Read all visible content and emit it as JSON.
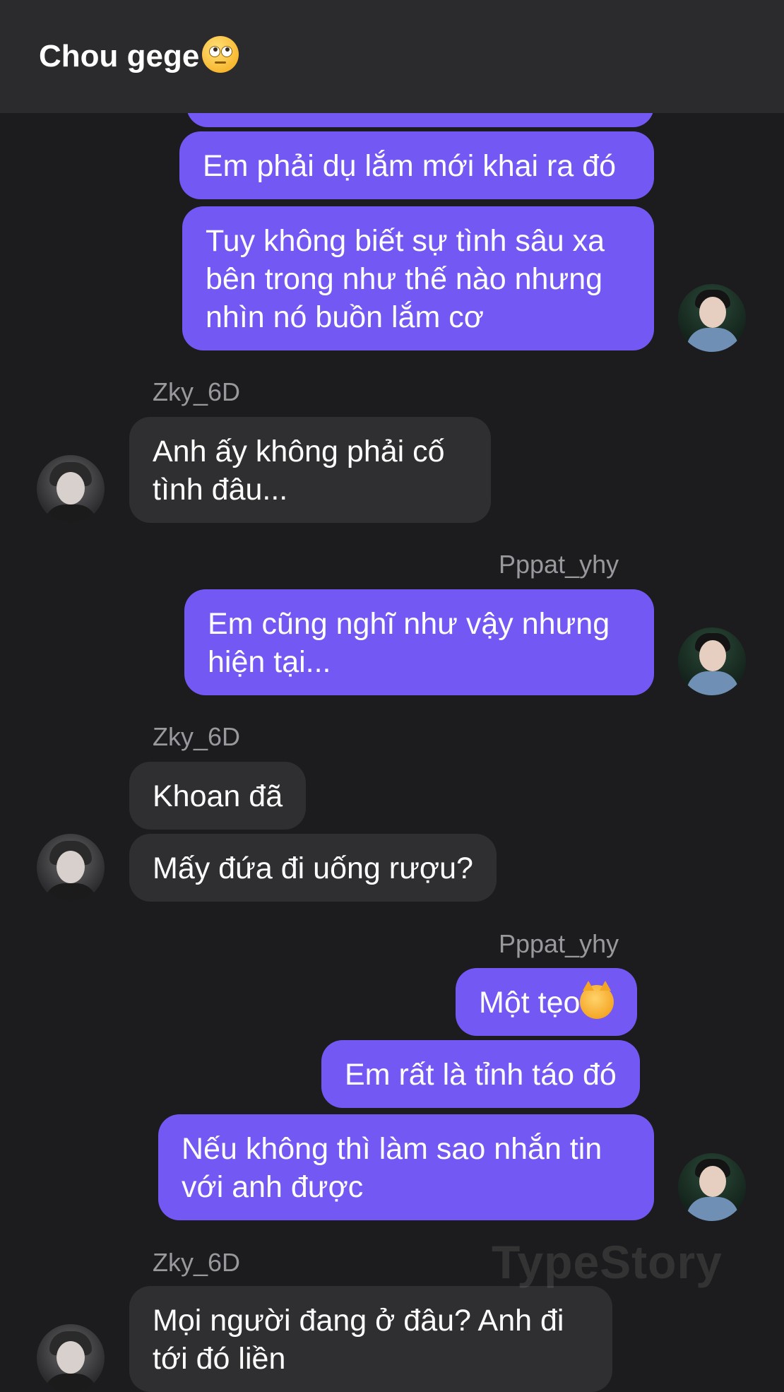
{
  "header": {
    "title": "Chou gege",
    "title_emoji": "face-with-rolling-eyes-icon"
  },
  "messages": [
    {
      "text": "Em phải dụ lắm mới khai ra đó"
    },
    {
      "text": "Tuy không biết sự tình sâu xa bên trong như thế nào nhưng nhìn nó buồn lắm cơ"
    },
    {
      "sender": "Zky_6D"
    },
    {
      "text": "Anh ấy không phải cố tình đâu..."
    },
    {
      "sender": "Pppat_yhy"
    },
    {
      "text": "Em cũng nghĩ như vậy nhưng hiện tại..."
    },
    {
      "sender": "Zky_6D"
    },
    {
      "text": "Khoan đã"
    },
    {
      "text": "Mấy đứa đi uống rượu?"
    },
    {
      "sender": "Pppat_yhy"
    },
    {
      "text": "Một tẹo",
      "emoji": "kissing-cat-icon"
    },
    {
      "text": "Em rất là tỉnh táo đó"
    },
    {
      "text": "Nếu không thì làm sao nhắn tin với anh được"
    },
    {
      "sender": "Zky_6D"
    },
    {
      "text": "Mọi người đang ở đâu? Anh đi tới đó liền"
    }
  ],
  "watermark": "TypeStory",
  "colors": {
    "outgoing": "#7358f4",
    "incoming": "#2f2f31",
    "background": "#1c1c1e",
    "header": "#2b2b2d"
  }
}
